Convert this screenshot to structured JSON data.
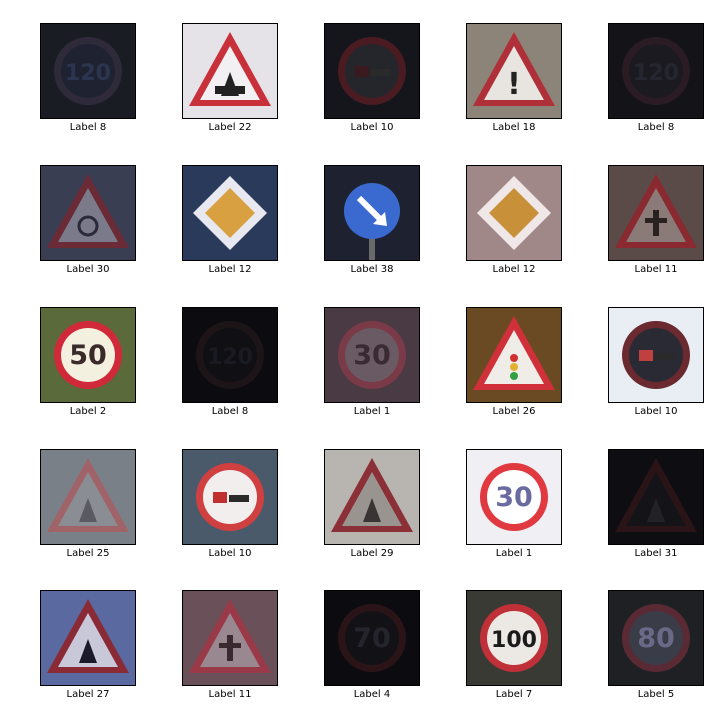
{
  "grid": {
    "cells": [
      {
        "label": "Label 8",
        "text": "120",
        "kind": "circle",
        "bg": "#1a1c24",
        "ring": "#2e2a3a",
        "fill": "#1f2230",
        "ink": "#2c3550"
      },
      {
        "label": "Label 22",
        "text": "",
        "kind": "triangle",
        "bg": "#e6e3e8",
        "ring": "#c8303a",
        "fill": "#f2f0f2",
        "ink": "#222222"
      },
      {
        "label": "Label 10",
        "text": "",
        "kind": "circle-nopass",
        "bg": "#15151c",
        "ring": "#4a1c22",
        "fill": "#25252c",
        "ink": "#3a1a1e"
      },
      {
        "label": "Label 18",
        "text": "!",
        "kind": "triangle",
        "bg": "#8c8478",
        "ring": "#b0303a",
        "fill": "#e8e4e0",
        "ink": "#222222"
      },
      {
        "label": "Label 8",
        "text": "120",
        "kind": "circle",
        "bg": "#141418",
        "ring": "#2a1c22",
        "fill": "#1a1a20",
        "ink": "#262630"
      },
      {
        "label": "Label 30",
        "text": "",
        "kind": "triangle-snow",
        "bg": "#3a3e52",
        "ring": "#6a2a36",
        "fill": "#7a7a8a",
        "ink": "#2a2a3a"
      },
      {
        "label": "Label 12",
        "text": "",
        "kind": "diamond",
        "bg": "#2a3a5a",
        "ring": "#e8e8f0",
        "fill": "#d8a040",
        "ink": "#e8e8f0"
      },
      {
        "label": "Label 38",
        "text": "",
        "kind": "blue-arrow",
        "bg": "#1e2230",
        "ring": "#3a6ad0",
        "fill": "#3a6ad0",
        "ink": "#ffffff"
      },
      {
        "label": "Label 12",
        "text": "",
        "kind": "diamond",
        "bg": "#a08888",
        "ring": "#f0e8e8",
        "fill": "#c89038",
        "ink": "#f0e8e8"
      },
      {
        "label": "Label 11",
        "text": "",
        "kind": "triangle-cross",
        "bg": "#5a4a48",
        "ring": "#8a2a30",
        "fill": "#8a7a78",
        "ink": "#2a2220"
      },
      {
        "label": "Label 2",
        "text": "50",
        "kind": "circle",
        "bg": "#5a6a3a",
        "ring": "#d02a3a",
        "fill": "#f4f0e0",
        "ink": "#3a2a2a"
      },
      {
        "label": "Label 8",
        "text": "120",
        "kind": "circle",
        "bg": "#0c0c10",
        "ring": "#1c1416",
        "fill": "#101014",
        "ink": "#1a1a22"
      },
      {
        "label": "Label 1",
        "text": "30",
        "kind": "circle",
        "bg": "#4a3a44",
        "ring": "#7a3a48",
        "fill": "#6a5a64",
        "ink": "#3a2a34"
      },
      {
        "label": "Label 26",
        "text": "",
        "kind": "triangle-light",
        "bg": "#6a4a22",
        "ring": "#d0303a",
        "fill": "#f0ece8",
        "ink": "#303030"
      },
      {
        "label": "Label 10",
        "text": "",
        "kind": "circle-nopass",
        "bg": "#e8eef4",
        "ring": "#6a2a30",
        "fill": "#2a2a34",
        "ink": "#c04040"
      },
      {
        "label": "Label 25",
        "text": "",
        "kind": "triangle-work",
        "bg": "#7a8088",
        "ring": "#a06468",
        "fill": "#8a8e94",
        "ink": "#5a5a62"
      },
      {
        "label": "Label 10",
        "text": "",
        "kind": "circle-nopass",
        "bg": "#4a5a6a",
        "ring": "#d04040",
        "fill": "#f2eeee",
        "ink": "#c03030"
      },
      {
        "label": "Label 29",
        "text": "",
        "kind": "triangle-bike",
        "bg": "#b8b4b0",
        "ring": "#8a3036",
        "fill": "#9a9490",
        "ink": "#3a3434"
      },
      {
        "label": "Label 1",
        "text": "30",
        "kind": "circle",
        "bg": "#f0f0f4",
        "ring": "#e03a40",
        "fill": "#ffffff",
        "ink": "#6a6aa0"
      },
      {
        "label": "Label 31",
        "text": "",
        "kind": "triangle-deer",
        "bg": "#0e0e12",
        "ring": "#2a1418",
        "fill": "#141418",
        "ink": "#222226"
      },
      {
        "label": "Label 27",
        "text": "",
        "kind": "triangle-ped",
        "bg": "#5a6aa0",
        "ring": "#8a2a34",
        "fill": "#c8c8d8",
        "ink": "#1a1a2a"
      },
      {
        "label": "Label 11",
        "text": "",
        "kind": "triangle-cross",
        "bg": "#6a5058",
        "ring": "#9a3a48",
        "fill": "#9a8890",
        "ink": "#3a2a30"
      },
      {
        "label": "Label 4",
        "text": "70",
        "kind": "circle",
        "bg": "#0c0c10",
        "ring": "#2a1418",
        "fill": "#121216",
        "ink": "#24242c"
      },
      {
        "label": "Label 7",
        "text": "100",
        "kind": "circle",
        "bg": "#3a3a34",
        "ring": "#c03038",
        "fill": "#ece8e4",
        "ink": "#1a1a1a"
      },
      {
        "label": "Label 5",
        "text": "80",
        "kind": "circle",
        "bg": "#1e2024",
        "ring": "#5a2a34",
        "fill": "#3a3c48",
        "ink": "#6a6a88"
      }
    ]
  }
}
